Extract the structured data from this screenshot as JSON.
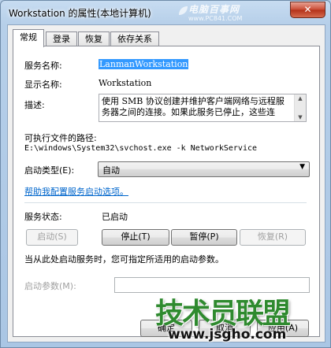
{
  "window": {
    "title": "Workstation 的属性(本地计算机)",
    "close_label": "✕"
  },
  "watermark": {
    "site_name": "电脑百事网",
    "site_url": "www.PC841.COM",
    "brand": "技术员联盟",
    "url": "www.jsgho.com"
  },
  "tabs": [
    {
      "label": "常规",
      "active": true
    },
    {
      "label": "登录",
      "active": false
    },
    {
      "label": "恢复",
      "active": false
    },
    {
      "label": "依存关系",
      "active": false
    }
  ],
  "general": {
    "service_name_label": "服务名称:",
    "service_name_value": "LanmanWorkstation",
    "display_name_label": "显示名称:",
    "display_name_value": "Workstation",
    "description_label": "描述:",
    "description_value": "使用 SMB 协议创建并维护客户端网络与远程服务器之间的连接。如果此服务已停止，这些连",
    "exe_path_label": "可执行文件的路径:",
    "exe_path_value": "E:\\windows\\System32\\svchost.exe -k NetworkService",
    "startup_type_label": "启动类型(E):",
    "startup_type_value": "自动",
    "help_link": "帮助我配置服务启动选项。",
    "status_label": "服务状态:",
    "status_value": "已启动",
    "buttons": {
      "start": "启动(S)",
      "stop": "停止(T)",
      "pause": "暂停(P)",
      "resume": "恢复(R)"
    },
    "hint": "当从此处启动服务时，您可指定所适用的启动参数。",
    "start_params_label": "启动参数(M):",
    "start_params_value": ""
  },
  "footer": {
    "ok": "确定",
    "cancel": "取消",
    "apply": "应用(A)"
  }
}
